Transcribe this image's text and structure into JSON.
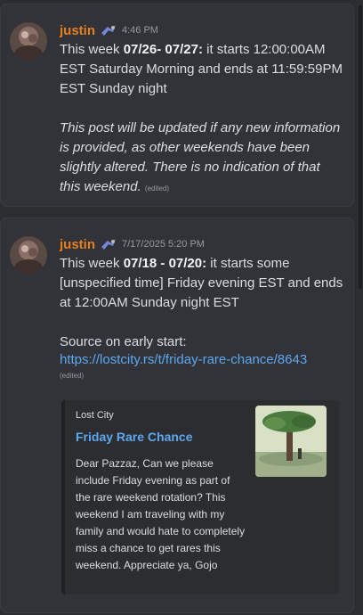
{
  "messages": [
    {
      "username": "justin",
      "timestamp": "4:46 PM",
      "line1_prefix": "This week ",
      "line1_bold": "07/26- 07/27:",
      "line1_rest": " it starts 12:00:00AM EST Saturday Morning and ends at 11:59:59PM EST Sunday night",
      "note": "This post will be updated if any new information is provided, as other weekends have been slightly altered. There is no indication of that this weekend.",
      "edited": "(edited)"
    },
    {
      "username": "justin",
      "timestamp": "7/17/2025 5:20 PM",
      "line1_prefix": "This week ",
      "line1_bold": "07/18 - 07/20:",
      "line1_rest": " it starts some [unspecified time] Friday evening EST and ends at 12:00AM Sunday night EST",
      "source_label": "Source on early start:",
      "source_link": "https://lostcity.rs/t/friday-rare-chance/8643",
      "edited": "(edited)",
      "embed": {
        "provider": "Lost City",
        "title": "Friday Rare Chance",
        "description": "Dear Pazzaz, Can we please include Friday evening as part of the rare weekend rotation? This weekend I am traveling with my family and would hate to completely miss a chance to get rares this weekend. Appreciate ya, Gojo"
      }
    }
  ],
  "colors": {
    "username": "#e67e22",
    "link": "#5ea8f0",
    "background": "#2b2d31",
    "message_bg": "#313338"
  }
}
